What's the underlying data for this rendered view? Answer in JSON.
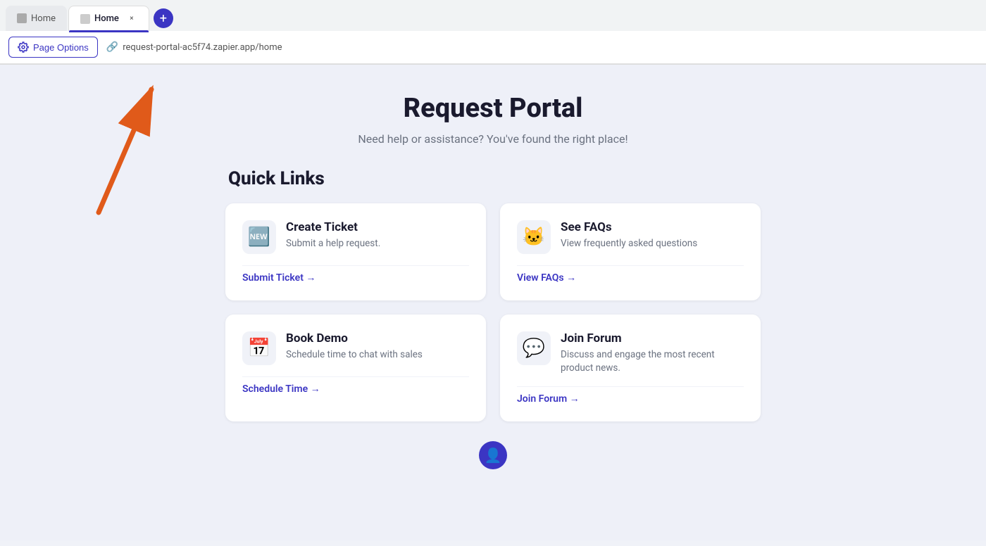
{
  "browser": {
    "tab_inactive_label": "Home",
    "tab_active_label": "Home",
    "tab_close_label": "×",
    "tab_add_label": "+",
    "page_options_label": "Page Options",
    "url": "request-portal-ac5f74.zapier.app/home"
  },
  "page": {
    "title": "Request Portal",
    "subtitle": "Need help or assistance? You've found the right place!"
  },
  "quick_links": {
    "section_title": "Quick Links",
    "cards": [
      {
        "id": "create-ticket",
        "icon": "🆕",
        "title": "Create Ticket",
        "description": "Submit a help request.",
        "link_label": "Submit Ticket →"
      },
      {
        "id": "see-faqs",
        "icon": "🐱",
        "title": "See FAQs",
        "description": "View frequently asked questions",
        "link_label": "View FAQs →"
      },
      {
        "id": "book-demo",
        "icon": "📅",
        "title": "Book Demo",
        "description": "Schedule time to chat with sales",
        "link_label": "Schedule Time →"
      },
      {
        "id": "join-forum",
        "icon": "💬",
        "title": "Join Forum",
        "description": "Discuss and engage the most recent product news.",
        "link_label": "Join Forum →"
      }
    ]
  },
  "colors": {
    "accent": "#3b35c3",
    "text_primary": "#1a1a2e",
    "text_secondary": "#6b7280",
    "bg_light": "#eef0f8"
  }
}
